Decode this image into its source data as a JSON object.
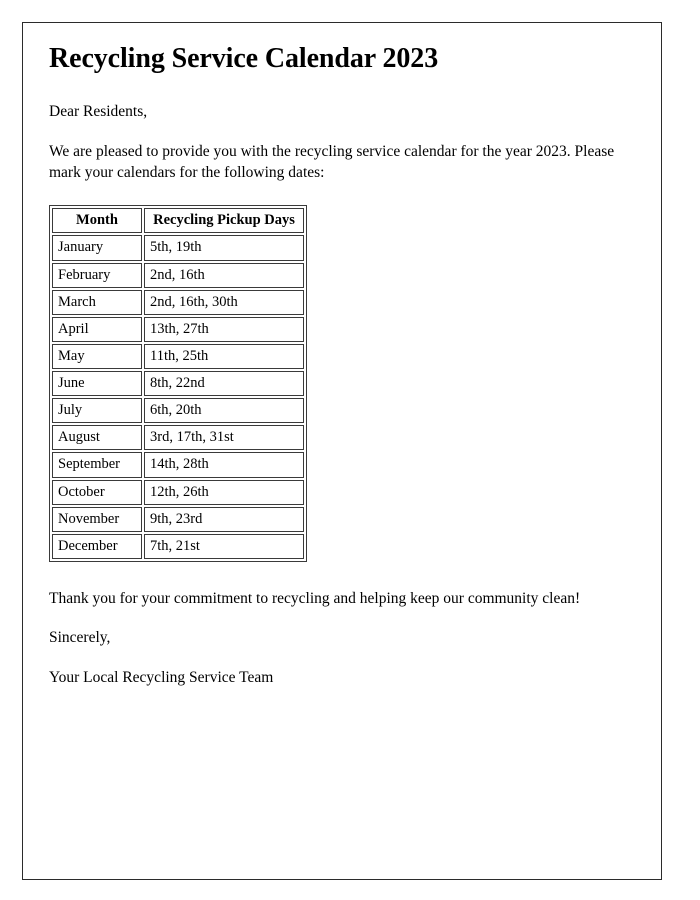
{
  "document": {
    "title": "Recycling Service Calendar 2023",
    "salutation": "Dear Residents,",
    "intro": "We are pleased to provide you with the recycling service calendar for the year 2023. Please mark your calendars for the following dates:",
    "thanks": "Thank you for your commitment to recycling and helping keep our community clean!",
    "signoff": "Sincerely,",
    "signature": "Your Local Recycling Service Team"
  },
  "schedule": {
    "columns": [
      "Month",
      "Recycling Pickup Days"
    ],
    "rows": [
      {
        "month": "January",
        "days": "5th, 19th"
      },
      {
        "month": "February",
        "days": "2nd, 16th"
      },
      {
        "month": "March",
        "days": "2nd, 16th, 30th"
      },
      {
        "month": "April",
        "days": "13th, 27th"
      },
      {
        "month": "May",
        "days": "11th, 25th"
      },
      {
        "month": "June",
        "days": "8th, 22nd"
      },
      {
        "month": "July",
        "days": "6th, 20th"
      },
      {
        "month": "August",
        "days": "3rd, 17th, 31st"
      },
      {
        "month": "September",
        "days": "14th, 28th"
      },
      {
        "month": "October",
        "days": "12th, 26th"
      },
      {
        "month": "November",
        "days": "9th, 23rd"
      },
      {
        "month": "December",
        "days": "7th, 21st"
      }
    ]
  },
  "colors": {
    "text": "#000000",
    "page_border": "#2b2b2b",
    "table_border": "#3a3a3a",
    "background": "#ffffff"
  }
}
